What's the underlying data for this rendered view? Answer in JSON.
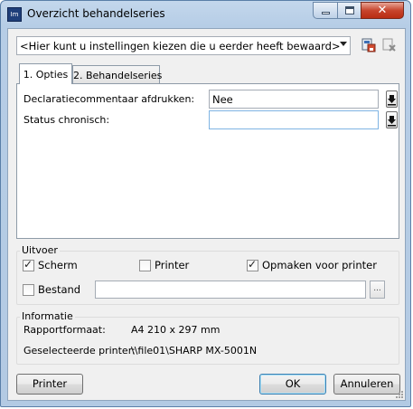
{
  "window": {
    "title": "Overzicht behandelseries"
  },
  "settings": {
    "combo_value": "<Hier kunt u instellingen kiezen die u eerder heeft bewaard>"
  },
  "tabs": [
    {
      "label": "1. Opties",
      "active": true
    },
    {
      "label": "2. Behandelseries",
      "active": false
    }
  ],
  "options": {
    "declaratie_label": "Declaratiecommentaar afdrukken:",
    "declaratie_value": "Nee",
    "status_label": "Status chronisch:",
    "status_value": ""
  },
  "uitvoer": {
    "title": "Uitvoer",
    "scherm": {
      "label": "Scherm",
      "checked": true
    },
    "printer": {
      "label": "Printer",
      "checked": false
    },
    "opmaken": {
      "label": "Opmaken voor printer",
      "checked": true
    },
    "bestand": {
      "label": "Bestand",
      "checked": false
    },
    "bestand_path": "",
    "browse_label": "..."
  },
  "informatie": {
    "title": "Informatie",
    "rapportformaat_label": "Rapportformaat:",
    "rapportformaat_value": "A4 210 x 297 mm",
    "printer_label": "Geselecteerde printer:",
    "printer_value": "\\\\file01\\SHARP MX-5001N"
  },
  "buttons": {
    "printer": "Printer",
    "ok": "OK",
    "cancel": "Annuleren"
  },
  "icons": {
    "app": "app-icon",
    "save_settings": "save-settings-icon",
    "delete_settings": "delete-settings-icon",
    "dropdown": "download-arrow-icon"
  },
  "colors": {
    "title_bar": "#b9cfe7",
    "close": "#c7452d",
    "ok_border": "#3c7fb1"
  }
}
